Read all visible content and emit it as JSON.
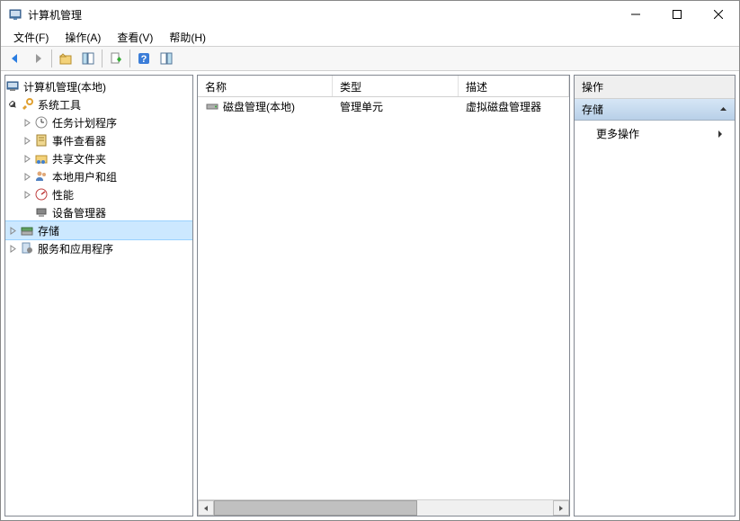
{
  "window": {
    "title": "计算机管理"
  },
  "menu": {
    "file": "文件(F)",
    "action": "操作(A)",
    "view": "查看(V)",
    "help": "帮助(H)"
  },
  "tree": {
    "root": "计算机管理(本地)",
    "systemTools": "系统工具",
    "taskScheduler": "任务计划程序",
    "eventViewer": "事件查看器",
    "sharedFolders": "共享文件夹",
    "localUsers": "本地用户和组",
    "performance": "性能",
    "deviceManager": "设备管理器",
    "storage": "存储",
    "services": "服务和应用程序"
  },
  "list": {
    "columns": {
      "name": "名称",
      "type": "类型",
      "desc": "描述"
    },
    "rows": [
      {
        "name": "磁盘管理(本地)",
        "type": "管理单元",
        "desc": "虚拟磁盘管理器"
      }
    ]
  },
  "actions": {
    "header": "操作",
    "section": "存储",
    "more": "更多操作"
  }
}
